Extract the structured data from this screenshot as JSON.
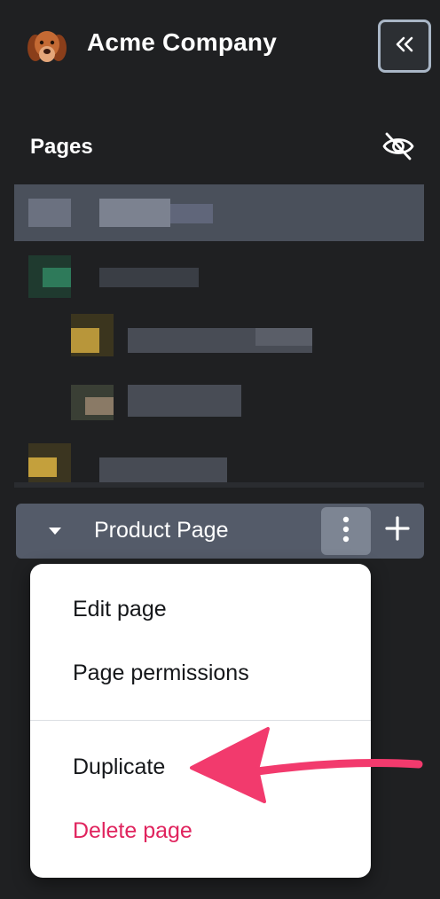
{
  "header": {
    "company_name": "Acme Company",
    "avatar_icon": "dog-avatar-icon",
    "collapse_icon": "double-chevron-left-icon"
  },
  "pages_section": {
    "title": "Pages",
    "visibility_icon": "eye-slash-icon"
  },
  "product_row": {
    "label": "Product Page",
    "caret_icon": "caret-down-icon",
    "more_icon": "vertical-ellipsis-icon",
    "add_icon": "plus-icon"
  },
  "menu": {
    "items": [
      {
        "label": "Edit page"
      },
      {
        "label": "Page permissions"
      },
      {
        "label": "Duplicate"
      },
      {
        "label": "Delete page"
      }
    ]
  },
  "colors": {
    "background": "#1f2022",
    "row_bg": "#545b69",
    "danger": "#e0245e",
    "arrow": "#f23a6d"
  }
}
